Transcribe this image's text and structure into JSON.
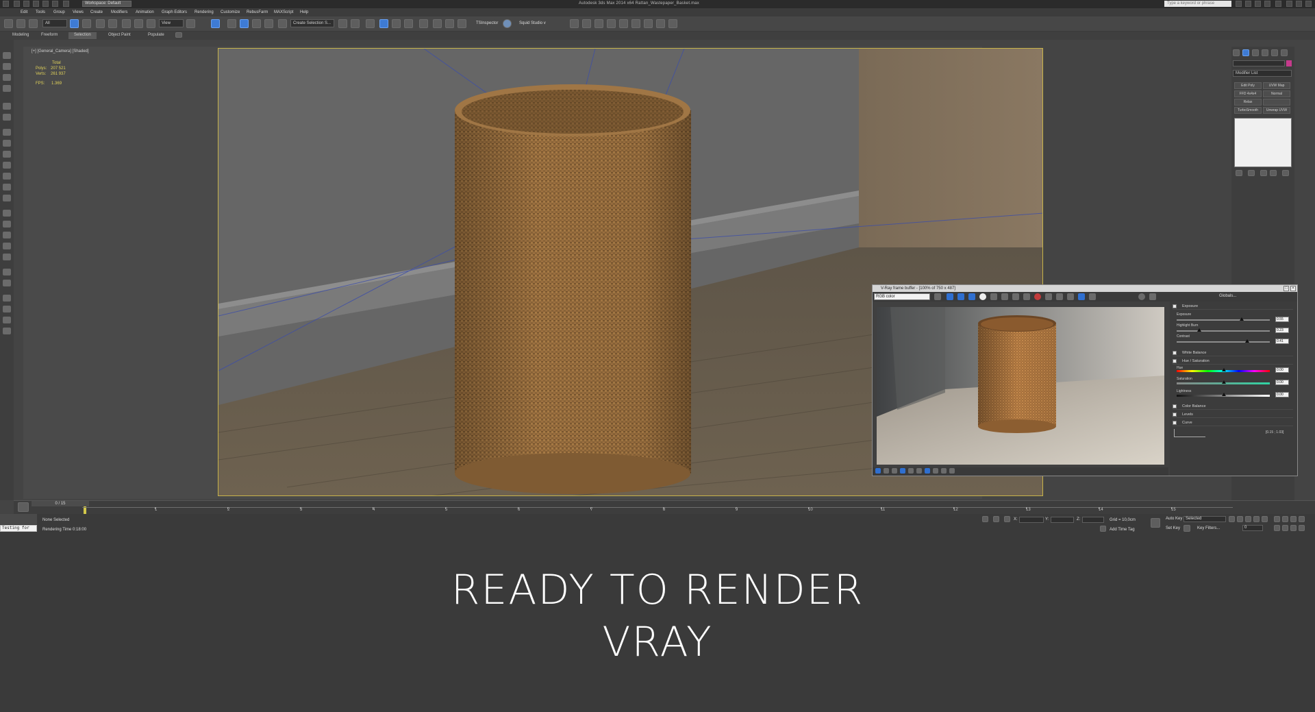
{
  "window": {
    "title": "Autodesk 3ds Max  2014 x64    Rattan_Wastepaper_Basket.max",
    "workspace": "Workspace: Default",
    "search_placeholder": "Type a keyword or phrase"
  },
  "menu": [
    "Edit",
    "Tools",
    "Group",
    "Views",
    "Create",
    "Modifiers",
    "Animation",
    "Graph Editors",
    "Rendering",
    "Customize",
    "RebusFarm",
    "MAXScript",
    "Help"
  ],
  "toolbar": {
    "filter_select": "All",
    "ref_coord": "View",
    "named_selection": "Create Selection S...",
    "plugin_1": "TSInspector",
    "plugin_2": "Squid Studio v"
  },
  "ribbon_tabs": [
    {
      "label": "Modeling",
      "active": false
    },
    {
      "label": "Freeform",
      "active": false
    },
    {
      "label": "Selection",
      "active": true
    },
    {
      "label": "Object Paint",
      "active": false
    },
    {
      "label": "Populate",
      "active": false
    }
  ],
  "viewport": {
    "label": "[+] [General_Camera] [Shaded]",
    "stats": {
      "header": "Total",
      "polys_label": "Polys:",
      "polys": "207 521",
      "verts_label": "Verts:",
      "verts": "261 937",
      "fps_label": "FPS:",
      "fps": "1.369"
    }
  },
  "command_panel": {
    "modifier_list": "Modifier List",
    "buttons": [
      "Edit Poly",
      "UVW Map",
      "FFD 4x4x4",
      "Normal",
      "Relax",
      "TurboSmooth",
      "Unwrap UVW"
    ]
  },
  "vfb": {
    "title": "V-Ray frame buffer - [100% of 750 x 487]",
    "channel": "RGB color",
    "globals_label": "Globals...",
    "rows": {
      "exposure": "Exposure",
      "white_balance": "White Balance",
      "hue_saturation": "Hue / Saturation",
      "color_balance": "Color Balance",
      "levels": "Levels",
      "curve": "Curve"
    },
    "sliders": {
      "exposure_label": "Exposure",
      "exposure": "0.55",
      "highlight_label": "Highlight Burn",
      "highlight": "0.23",
      "contrast_label": "Contrast",
      "contrast": "0.41",
      "hue_label": "Hue",
      "hue": "0.00",
      "saturation_label": "Saturation",
      "saturation": "0.00",
      "lightness_label": "Lightness",
      "lightness": "0.00"
    },
    "curve_value": "[0.15 ; 1.03]"
  },
  "timeline": {
    "slider": "0 / 15",
    "ticks": [
      "1",
      "2",
      "3",
      "4",
      "5",
      "6",
      "7",
      "8",
      "9",
      "10",
      "11",
      "12",
      "13",
      "14",
      "15"
    ]
  },
  "status": {
    "maxscript": "Testing for",
    "selection": "None Selected",
    "render_time": "Rendering Time  0:18:00",
    "x_label": "X:",
    "y_label": "Y:",
    "z_label": "Z:",
    "grid": "Grid = 10,0cm",
    "add_time_tag": "Add Time Tag",
    "auto_key": "Auto Key",
    "auto_key_mode": "Selected",
    "set_key": "Set Key",
    "key_filters": "Key Filters...",
    "frame": "0"
  },
  "caption": {
    "line1": "READY TO RENDER",
    "line2": "VRAY"
  },
  "colors": {
    "viewport_border": "#c8b44a",
    "stats_text": "#e2d35a",
    "accent_blue": "#3e7bd4",
    "caption_bg": "#3a3a3a"
  }
}
